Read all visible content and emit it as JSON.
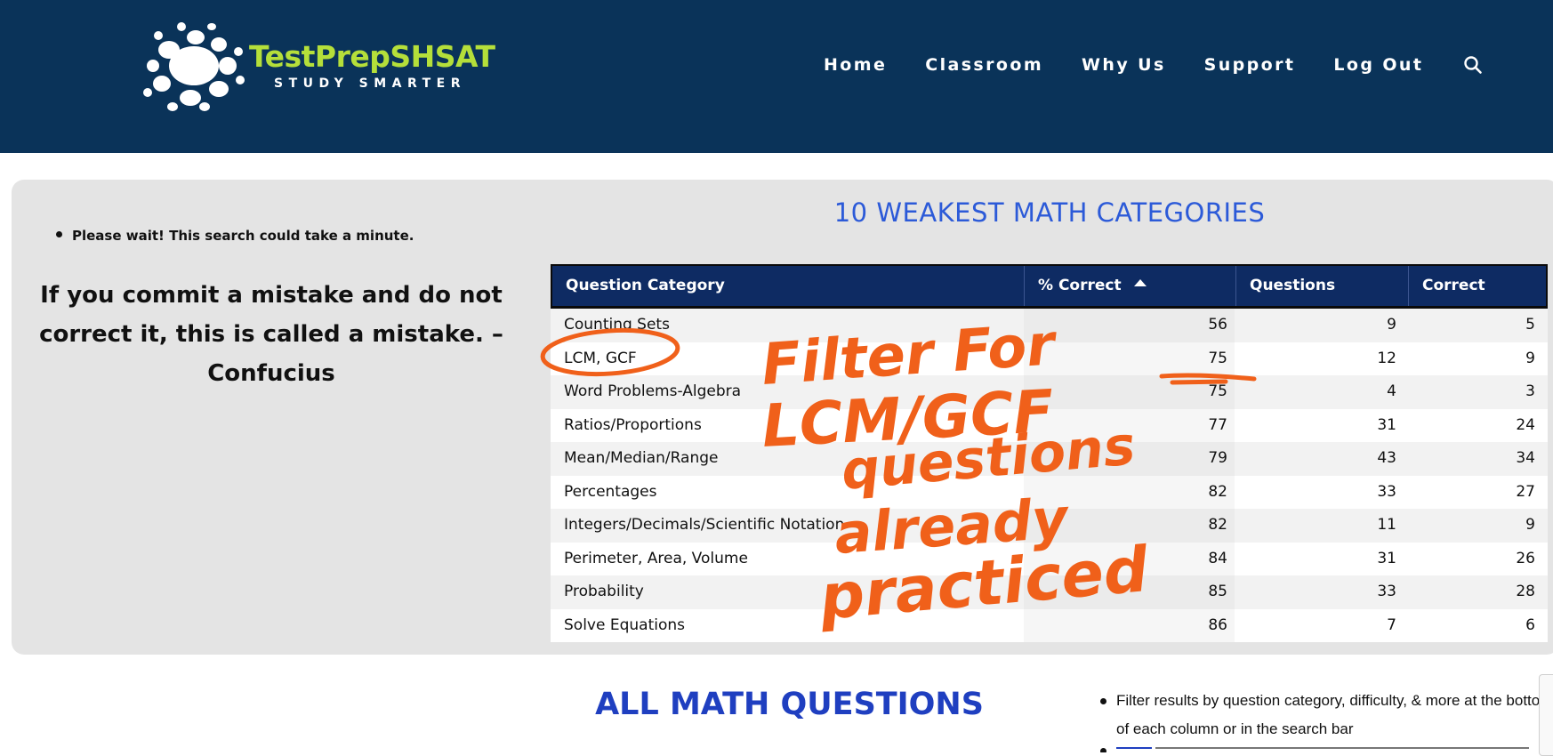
{
  "brand": {
    "name": "TestPrepSHSAT",
    "tagline": "STUDY SMARTER",
    "name_color": "#b5df3a",
    "header_color": "#0a3359"
  },
  "nav": {
    "items": [
      "Home",
      "Classroom",
      "Why Us",
      "Support",
      "Log Out"
    ],
    "search_icon": "search-icon"
  },
  "notice": "Please wait! This search could take a minute.",
  "quote": "If you commit a mistake and do not correct it, this is called a mistake.  – Confucius",
  "weakest": {
    "title": "10 WEAKEST MATH CATEGORIES",
    "title_color": "#2c5ad8",
    "columns": [
      "Question Category",
      "% Correct",
      "Questions",
      "Correct"
    ],
    "sort": {
      "column": "% Correct",
      "direction": "ascending"
    },
    "rows": [
      {
        "category": "Counting Sets",
        "pct": "56",
        "questions": "9",
        "correct": "5"
      },
      {
        "category": "LCM, GCF",
        "pct": "75",
        "questions": "12",
        "correct": "9"
      },
      {
        "category": "Word Problems-Algebra",
        "pct": "75",
        "questions": "4",
        "correct": "3"
      },
      {
        "category": "Ratios/Proportions",
        "pct": "77",
        "questions": "31",
        "correct": "24"
      },
      {
        "category": "Mean/Median/Range",
        "pct": "79",
        "questions": "43",
        "correct": "34"
      },
      {
        "category": "Percentages",
        "pct": "82",
        "questions": "33",
        "correct": "27"
      },
      {
        "category": "Integers/Decimals/Scientific Notation",
        "pct": "82",
        "questions": "11",
        "correct": "9"
      },
      {
        "category": "Perimeter, Area, Volume",
        "pct": "84",
        "questions": "31",
        "correct": "26"
      },
      {
        "category": "Probability",
        "pct": "85",
        "questions": "33",
        "correct": "28"
      },
      {
        "category": "Solve Equations",
        "pct": "86",
        "questions": "7",
        "correct": "6"
      }
    ]
  },
  "all_math": {
    "title": "ALL MATH QUESTIONS",
    "title_color": "#1f3fc0",
    "notes": [
      "Filter results by question category, difficulty, & more at the bottom of each column or in the search bar"
    ]
  },
  "annotation": {
    "color": "#f0601a",
    "lines": [
      "Filter For",
      "LCM/GCF",
      "questions",
      "already",
      "practiced"
    ]
  }
}
